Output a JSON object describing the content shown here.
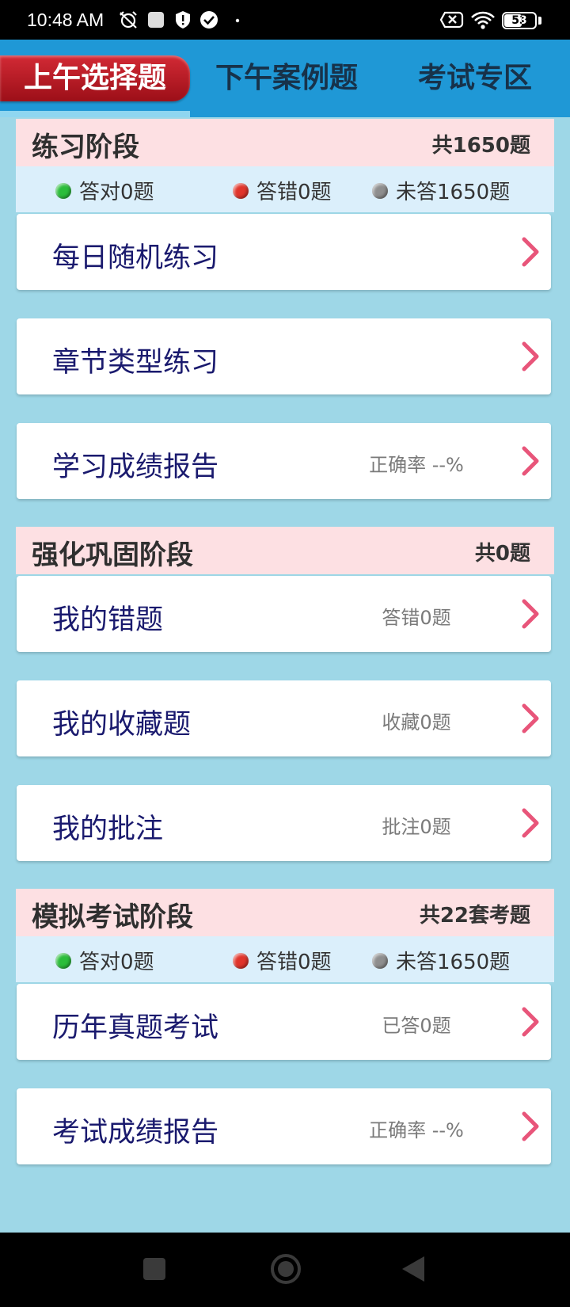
{
  "status": {
    "time": "10:48 AM",
    "battery": "53"
  },
  "tabs": [
    "上午选择题",
    "下午案例题",
    "考试专区"
  ],
  "practice": {
    "title": "练习阶段",
    "total": "共1650题",
    "stats": {
      "correct": "答对0题",
      "wrong": "答错0题",
      "unanswered": "未答1650题"
    },
    "items": [
      {
        "label": "每日随机练习",
        "info": ""
      },
      {
        "label": "章节类型练习",
        "info": ""
      },
      {
        "label": "学习成绩报告",
        "info": "正确率 --%"
      }
    ]
  },
  "reinforce": {
    "title": "强化巩固阶段",
    "total": "共0题",
    "items": [
      {
        "label": "我的错题",
        "info": "答错0题"
      },
      {
        "label": "我的收藏题",
        "info": "收藏0题"
      },
      {
        "label": "我的批注",
        "info": "批注0题"
      }
    ]
  },
  "mock": {
    "title": "模拟考试阶段",
    "total": "共22套考题",
    "stats": {
      "correct": "答对0题",
      "wrong": "答错0题",
      "unanswered": "未答1650题"
    },
    "items": [
      {
        "label": "历年真题考试",
        "info": "已答0题"
      },
      {
        "label": "考试成绩报告",
        "info": "正确率 --%"
      }
    ]
  },
  "colors": {
    "accent": "#1f98d6",
    "active_tab": "#b81a24",
    "background": "#9ed7e7",
    "chevron": "#e8557a",
    "header": "#fde0e3"
  }
}
